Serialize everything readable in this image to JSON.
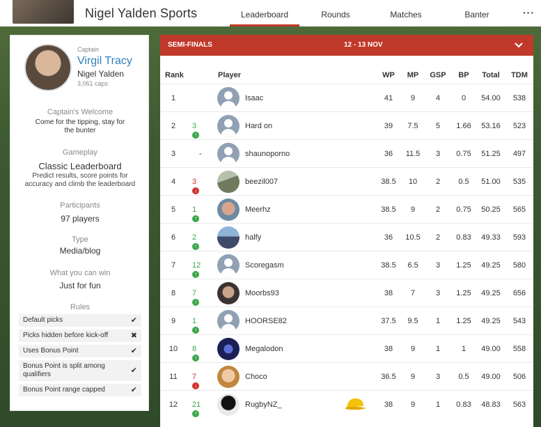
{
  "header": {
    "title": "Nigel Yalden Sports",
    "tabs": [
      {
        "label": "Leaderboard",
        "active": true
      },
      {
        "label": "Rounds",
        "active": false
      },
      {
        "label": "Matches",
        "active": false
      },
      {
        "label": "Banter",
        "active": false
      }
    ],
    "more": "···"
  },
  "captain": {
    "role": "Captain",
    "name": "Virgil Tracy",
    "team": "Nigel Yalden",
    "caps": "3,061 caps"
  },
  "info": {
    "welcome_title": "Captain's Welcome",
    "welcome_text": "Come for the tipping, stay for the bunter",
    "gameplay_title": "Gameplay",
    "gameplay_value": "Classic Leaderboard",
    "gameplay_desc": "Predict results, score points for accuracy and climb the leaderboard",
    "participants_title": "Participants",
    "participants_value": "97 players",
    "type_title": "Type",
    "type_value": "Media/blog",
    "win_title": "What you can win",
    "win_value": "Just for fun",
    "rules_title": "Rules"
  },
  "rules": [
    {
      "label": "Default picks",
      "mark": "✔"
    },
    {
      "label": "Picks hidden before kick-off",
      "mark": "✖"
    },
    {
      "label": "Uses Bonus Point",
      "mark": "✔"
    },
    {
      "label": "Bonus Point is split among qualifiers",
      "mark": "✔"
    },
    {
      "label": "Bonus Point range capped",
      "mark": "✔"
    }
  ],
  "round": {
    "name": "SEMI-FINALS",
    "dates": "12 - 13 NOV"
  },
  "columns": {
    "rank": "Rank",
    "player": "Player",
    "wp": "WP",
    "mp": "MP",
    "gsp": "GSP",
    "bp": "BP",
    "total": "Total",
    "tdm": "TDM"
  },
  "colors": {
    "accent": "#c0392b",
    "link": "#2f7fb8",
    "up": "#3aa64a",
    "down": "#d0312d"
  },
  "leaderboard": [
    {
      "rank": "1",
      "move": "",
      "dir": "none",
      "player": "Isaac",
      "avatar": "generic",
      "wp": "41",
      "mp": "9",
      "gsp": "4",
      "bp": "0",
      "total": "54.00",
      "tdm": "538"
    },
    {
      "rank": "2",
      "move": "3",
      "dir": "up",
      "player": "Hard on",
      "avatar": "generic",
      "wp": "39",
      "mp": "7.5",
      "gsp": "5",
      "bp": "1.66",
      "total": "53.16",
      "tdm": "523"
    },
    {
      "rank": "3",
      "move": "-",
      "dir": "none",
      "player": "shaunoporno",
      "avatar": "generic",
      "wp": "36",
      "mp": "11.5",
      "gsp": "3",
      "bp": "0.75",
      "total": "51.25",
      "tdm": "497"
    },
    {
      "rank": "4",
      "move": "3",
      "dir": "down",
      "player": "beezil007",
      "avatar": "photo",
      "wp": "38.5",
      "mp": "10",
      "gsp": "2",
      "bp": "0.5",
      "total": "51.00",
      "tdm": "535"
    },
    {
      "rank": "5",
      "move": "1",
      "dir": "up",
      "player": "Meerhz",
      "avatar": "photo",
      "wp": "38.5",
      "mp": "9",
      "gsp": "2",
      "bp": "0.75",
      "total": "50.25",
      "tdm": "565"
    },
    {
      "rank": "6",
      "move": "2",
      "dir": "up",
      "player": "halfy",
      "avatar": "photo",
      "wp": "36",
      "mp": "10.5",
      "gsp": "2",
      "bp": "0.83",
      "total": "49.33",
      "tdm": "593"
    },
    {
      "rank": "7",
      "move": "12",
      "dir": "up",
      "player": "Scoregasm",
      "avatar": "generic",
      "wp": "38.5",
      "mp": "6.5",
      "gsp": "3",
      "bp": "1.25",
      "total": "49.25",
      "tdm": "580"
    },
    {
      "rank": "8",
      "move": "7",
      "dir": "up",
      "player": "Moorbs93",
      "avatar": "photo",
      "wp": "38",
      "mp": "7",
      "gsp": "3",
      "bp": "1.25",
      "total": "49.25",
      "tdm": "656"
    },
    {
      "rank": "9",
      "move": "1",
      "dir": "up",
      "player": "HOORSE82",
      "avatar": "generic",
      "wp": "37.5",
      "mp": "9.5",
      "gsp": "1",
      "bp": "1.25",
      "total": "49.25",
      "tdm": "543"
    },
    {
      "rank": "10",
      "move": "8",
      "dir": "up",
      "player": "Megalodon",
      "avatar": "photo",
      "wp": "38",
      "mp": "9",
      "gsp": "1",
      "bp": "1",
      "total": "49.00",
      "tdm": "558"
    },
    {
      "rank": "11",
      "move": "7",
      "dir": "down",
      "player": "Choco",
      "avatar": "photo",
      "wp": "36.5",
      "mp": "9",
      "gsp": "3",
      "bp": "0.5",
      "total": "49.00",
      "tdm": "506"
    },
    {
      "rank": "12",
      "move": "21",
      "dir": "up",
      "player": "RugbyNZ_",
      "avatar": "photo",
      "cap": true,
      "wp": "38",
      "mp": "9",
      "gsp": "1",
      "bp": "0.83",
      "total": "48.83",
      "tdm": "563"
    }
  ]
}
